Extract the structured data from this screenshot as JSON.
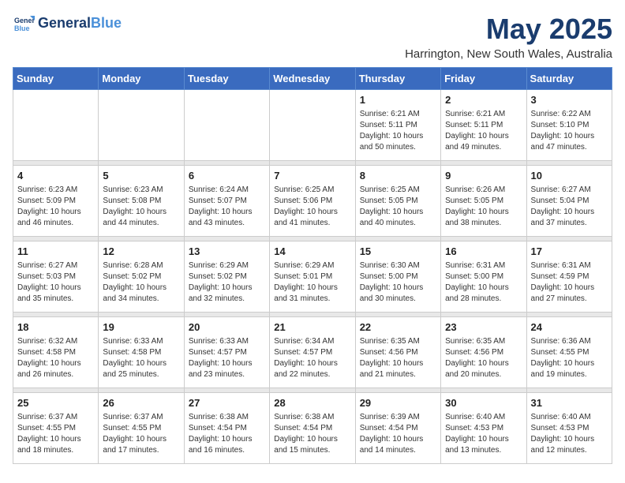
{
  "header": {
    "logo_line1": "General",
    "logo_line2": "Blue",
    "month_title": "May 2025",
    "location": "Harrington, New South Wales, Australia"
  },
  "weekdays": [
    "Sunday",
    "Monday",
    "Tuesday",
    "Wednesday",
    "Thursday",
    "Friday",
    "Saturday"
  ],
  "weeks": [
    [
      {
        "day": "",
        "info": ""
      },
      {
        "day": "",
        "info": ""
      },
      {
        "day": "",
        "info": ""
      },
      {
        "day": "",
        "info": ""
      },
      {
        "day": "1",
        "info": "Sunrise: 6:21 AM\nSunset: 5:11 PM\nDaylight: 10 hours\nand 50 minutes."
      },
      {
        "day": "2",
        "info": "Sunrise: 6:21 AM\nSunset: 5:11 PM\nDaylight: 10 hours\nand 49 minutes."
      },
      {
        "day": "3",
        "info": "Sunrise: 6:22 AM\nSunset: 5:10 PM\nDaylight: 10 hours\nand 47 minutes."
      }
    ],
    [
      {
        "day": "4",
        "info": "Sunrise: 6:23 AM\nSunset: 5:09 PM\nDaylight: 10 hours\nand 46 minutes."
      },
      {
        "day": "5",
        "info": "Sunrise: 6:23 AM\nSunset: 5:08 PM\nDaylight: 10 hours\nand 44 minutes."
      },
      {
        "day": "6",
        "info": "Sunrise: 6:24 AM\nSunset: 5:07 PM\nDaylight: 10 hours\nand 43 minutes."
      },
      {
        "day": "7",
        "info": "Sunrise: 6:25 AM\nSunset: 5:06 PM\nDaylight: 10 hours\nand 41 minutes."
      },
      {
        "day": "8",
        "info": "Sunrise: 6:25 AM\nSunset: 5:05 PM\nDaylight: 10 hours\nand 40 minutes."
      },
      {
        "day": "9",
        "info": "Sunrise: 6:26 AM\nSunset: 5:05 PM\nDaylight: 10 hours\nand 38 minutes."
      },
      {
        "day": "10",
        "info": "Sunrise: 6:27 AM\nSunset: 5:04 PM\nDaylight: 10 hours\nand 37 minutes."
      }
    ],
    [
      {
        "day": "11",
        "info": "Sunrise: 6:27 AM\nSunset: 5:03 PM\nDaylight: 10 hours\nand 35 minutes."
      },
      {
        "day": "12",
        "info": "Sunrise: 6:28 AM\nSunset: 5:02 PM\nDaylight: 10 hours\nand 34 minutes."
      },
      {
        "day": "13",
        "info": "Sunrise: 6:29 AM\nSunset: 5:02 PM\nDaylight: 10 hours\nand 32 minutes."
      },
      {
        "day": "14",
        "info": "Sunrise: 6:29 AM\nSunset: 5:01 PM\nDaylight: 10 hours\nand 31 minutes."
      },
      {
        "day": "15",
        "info": "Sunrise: 6:30 AM\nSunset: 5:00 PM\nDaylight: 10 hours\nand 30 minutes."
      },
      {
        "day": "16",
        "info": "Sunrise: 6:31 AM\nSunset: 5:00 PM\nDaylight: 10 hours\nand 28 minutes."
      },
      {
        "day": "17",
        "info": "Sunrise: 6:31 AM\nSunset: 4:59 PM\nDaylight: 10 hours\nand 27 minutes."
      }
    ],
    [
      {
        "day": "18",
        "info": "Sunrise: 6:32 AM\nSunset: 4:58 PM\nDaylight: 10 hours\nand 26 minutes."
      },
      {
        "day": "19",
        "info": "Sunrise: 6:33 AM\nSunset: 4:58 PM\nDaylight: 10 hours\nand 25 minutes."
      },
      {
        "day": "20",
        "info": "Sunrise: 6:33 AM\nSunset: 4:57 PM\nDaylight: 10 hours\nand 23 minutes."
      },
      {
        "day": "21",
        "info": "Sunrise: 6:34 AM\nSunset: 4:57 PM\nDaylight: 10 hours\nand 22 minutes."
      },
      {
        "day": "22",
        "info": "Sunrise: 6:35 AM\nSunset: 4:56 PM\nDaylight: 10 hours\nand 21 minutes."
      },
      {
        "day": "23",
        "info": "Sunrise: 6:35 AM\nSunset: 4:56 PM\nDaylight: 10 hours\nand 20 minutes."
      },
      {
        "day": "24",
        "info": "Sunrise: 6:36 AM\nSunset: 4:55 PM\nDaylight: 10 hours\nand 19 minutes."
      }
    ],
    [
      {
        "day": "25",
        "info": "Sunrise: 6:37 AM\nSunset: 4:55 PM\nDaylight: 10 hours\nand 18 minutes."
      },
      {
        "day": "26",
        "info": "Sunrise: 6:37 AM\nSunset: 4:55 PM\nDaylight: 10 hours\nand 17 minutes."
      },
      {
        "day": "27",
        "info": "Sunrise: 6:38 AM\nSunset: 4:54 PM\nDaylight: 10 hours\nand 16 minutes."
      },
      {
        "day": "28",
        "info": "Sunrise: 6:38 AM\nSunset: 4:54 PM\nDaylight: 10 hours\nand 15 minutes."
      },
      {
        "day": "29",
        "info": "Sunrise: 6:39 AM\nSunset: 4:54 PM\nDaylight: 10 hours\nand 14 minutes."
      },
      {
        "day": "30",
        "info": "Sunrise: 6:40 AM\nSunset: 4:53 PM\nDaylight: 10 hours\nand 13 minutes."
      },
      {
        "day": "31",
        "info": "Sunrise: 6:40 AM\nSunset: 4:53 PM\nDaylight: 10 hours\nand 12 minutes."
      }
    ]
  ]
}
